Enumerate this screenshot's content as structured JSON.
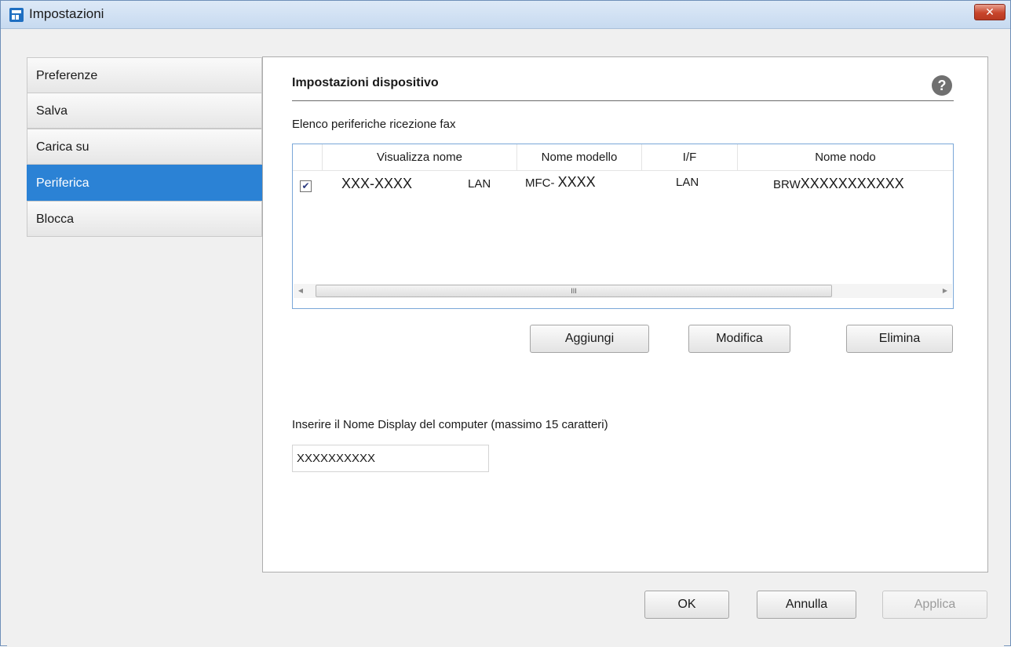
{
  "window": {
    "title": "Impostazioni",
    "close_label": "✕"
  },
  "sidebar": {
    "items": [
      {
        "label": "Preferenze"
      },
      {
        "label": "Salva"
      },
      {
        "label": "Carica su"
      },
      {
        "label": "Periferica",
        "selected": true
      },
      {
        "label": "Blocca"
      }
    ]
  },
  "panel": {
    "title": "Impostazioni dispositivo",
    "help_label": "?",
    "list_label": "Elenco periferiche ricezione fax",
    "columns": [
      "Visualizza nome",
      "Nome modello",
      "I/F",
      "Nome nodo"
    ],
    "rows": [
      {
        "checked": true,
        "check_mark": "✔",
        "display_name": "XXX-XXXX",
        "display_if": "LAN",
        "model_prefix": "MFC- ",
        "model_value": "XXXX",
        "interface": "LAN",
        "node_prefix": "BRW",
        "node_value": "XXXXXXXXXXX"
      }
    ],
    "scrollbar": {
      "left_arrow": "◀",
      "right_arrow": "▶",
      "thumb_grip": "III"
    },
    "buttons": {
      "add": "Aggiungi",
      "edit": "Modifica",
      "delete": "Elimina"
    },
    "name_label": "Inserire il Nome Display del computer (massimo 15 caratteri)",
    "name_value": "XXXXXXXXXX"
  },
  "footer": {
    "ok": "OK",
    "cancel": "Annulla",
    "apply": "Applica",
    "apply_enabled": false
  },
  "colors": {
    "selection": "#2b82d5",
    "title_bar": "#c7daf0",
    "close_button": "#c8452b"
  }
}
